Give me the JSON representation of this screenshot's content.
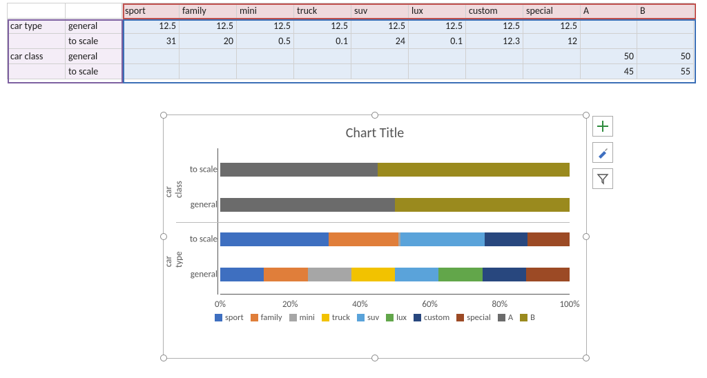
{
  "table": {
    "col_headers": [
      "sport",
      "family",
      "mini",
      "truck",
      "suv",
      "lux",
      "custom",
      "special",
      "A",
      "B"
    ],
    "row_groups": [
      {
        "name": "car type",
        "rows": [
          {
            "label": "general",
            "values": [
              12.5,
              12.5,
              12.5,
              12.5,
              12.5,
              12.5,
              12.5,
              12.5,
              null,
              null
            ]
          },
          {
            "label": "to scale",
            "values": [
              31,
              20,
              0.5,
              0.1,
              24,
              0.1,
              12.3,
              12,
              null,
              null
            ]
          }
        ]
      },
      {
        "name": "car class",
        "rows": [
          {
            "label": "general",
            "values": [
              null,
              null,
              null,
              null,
              null,
              null,
              null,
              null,
              50,
              50
            ]
          },
          {
            "label": "to scale",
            "values": [
              null,
              null,
              null,
              null,
              null,
              null,
              null,
              null,
              45,
              55
            ]
          }
        ]
      }
    ]
  },
  "chart": {
    "title": "Chart Title",
    "ticks": [
      "0%",
      "20%",
      "40%",
      "60%",
      "80%",
      "100%"
    ],
    "tools": {
      "add": "chart-elements",
      "style": "chart-styles",
      "filter": "chart-filter"
    }
  },
  "chart_data": {
    "type": "bar",
    "stacked": "percent",
    "orientation": "horizontal",
    "title": "Chart Title",
    "xlabel": "",
    "xlim": [
      0,
      100
    ],
    "xticks": [
      0,
      20,
      40,
      60,
      80,
      100
    ],
    "series": [
      {
        "name": "sport",
        "color": "#3e6fc0"
      },
      {
        "name": "family",
        "color": "#e07e3a"
      },
      {
        "name": "mini",
        "color": "#a6a6a6"
      },
      {
        "name": "truck",
        "color": "#f2c200"
      },
      {
        "name": "suv",
        "color": "#5aa3da"
      },
      {
        "name": "lux",
        "color": "#62a64a"
      },
      {
        "name": "custom",
        "color": "#28477e"
      },
      {
        "name": "special",
        "color": "#9c4a25"
      },
      {
        "name": "A",
        "color": "#6b6b6b"
      },
      {
        "name": "B",
        "color": "#9a8a1e"
      }
    ],
    "categories": [
      {
        "group": "car class",
        "label": "to scale",
        "values": {
          "A": 45,
          "B": 55
        }
      },
      {
        "group": "car class",
        "label": "general",
        "values": {
          "A": 50,
          "B": 50
        }
      },
      {
        "group": "car type",
        "label": "to scale",
        "values": {
          "sport": 31,
          "family": 20,
          "mini": 0.5,
          "truck": 0.1,
          "suv": 24,
          "lux": 0.1,
          "custom": 12.3,
          "special": 12
        }
      },
      {
        "group": "car type",
        "label": "general",
        "values": {
          "sport": 12.5,
          "family": 12.5,
          "mini": 12.5,
          "truck": 12.5,
          "suv": 12.5,
          "lux": 12.5,
          "custom": 12.5,
          "special": 12.5
        }
      }
    ],
    "legend_position": "bottom"
  }
}
